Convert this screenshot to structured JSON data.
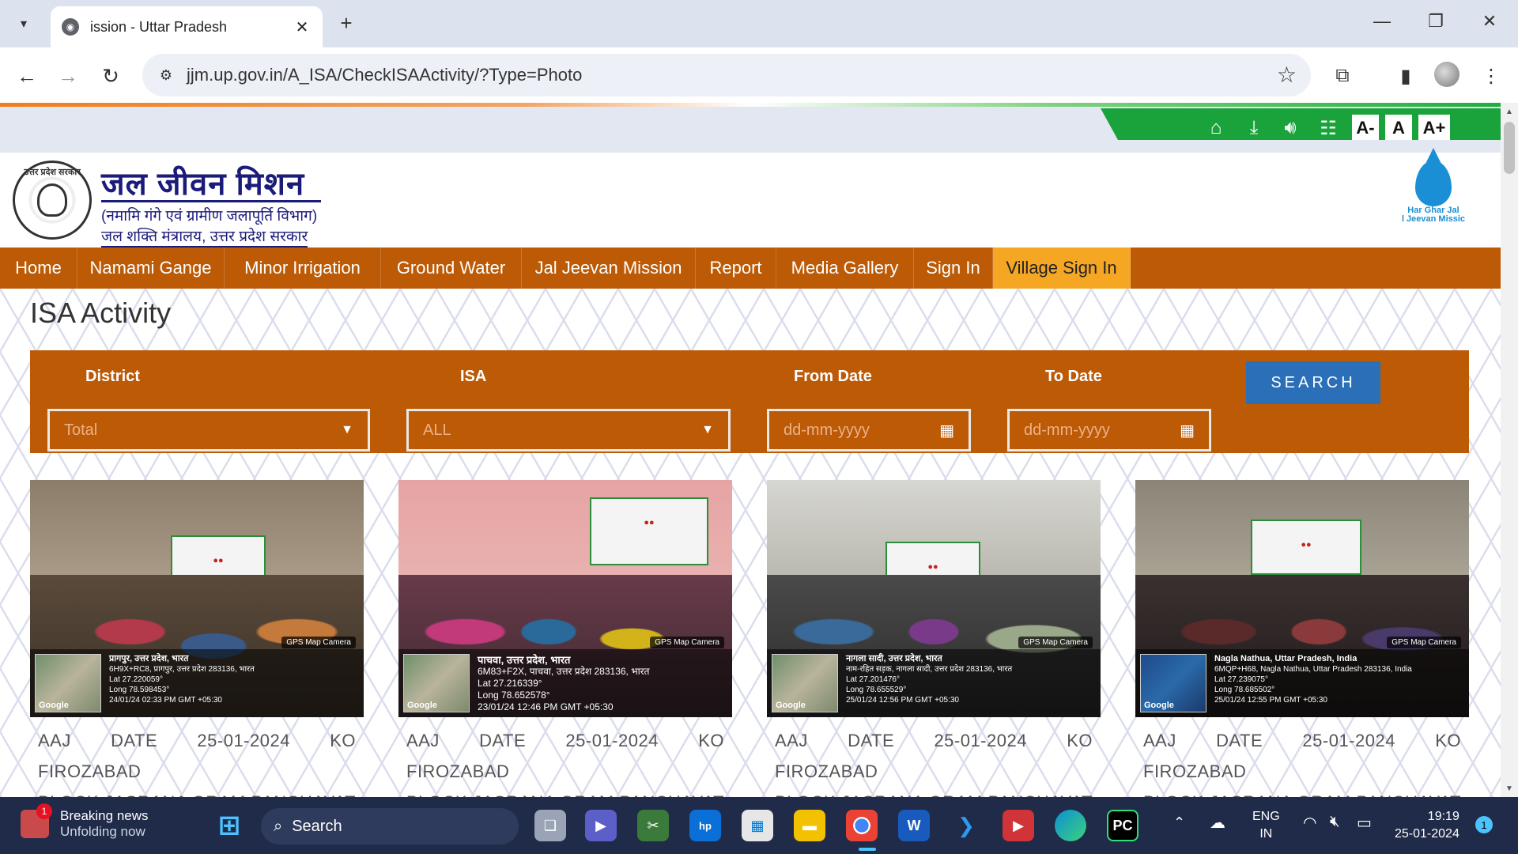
{
  "browser": {
    "tab_title": "ission - Uttar Pradesh",
    "url": "jjm.up.gov.in/A_ISA/CheckISAActivity/?Type=Photo"
  },
  "site": {
    "font_buttons": [
      "A-",
      "A",
      "A+"
    ],
    "title": "जल जीवन मिशन",
    "subtitle1": "(नमामि गंगे एवं ग्रामीण जलापूर्ति विभाग)",
    "subtitle2": "जल शक्ति मंत्रालय, उत्तर प्रदेश सरकार",
    "emblem_text": "उत्तर प्रदेश सरकार",
    "logo_right_line1": "Har Ghar Jal",
    "logo_right_line2": "l Jeevan Missic"
  },
  "menu": [
    "Home",
    "Namami Gange",
    "Minor Irrigation",
    "Ground Water",
    "Jal Jeevan Mission",
    "Report",
    "Media Gallery",
    "Sign In",
    "Village Sign In"
  ],
  "page": {
    "title": "ISA Activity",
    "filters": {
      "district_label": "District",
      "district_value": "Total",
      "isa_label": "ISA",
      "isa_value": "ALL",
      "from_label": "From Date",
      "from_placeholder": "dd-mm-yyyy",
      "to_label": "To Date",
      "to_placeholder": "dd-mm-yyyy",
      "search_label": "SEARCH"
    }
  },
  "cards": [
    {
      "gps_label": "GPS Map Camera",
      "map_label": "Google",
      "geo_line1": "प्रागपुर, उत्तर प्रदेश, भारत",
      "geo_line2": "6H9X+RC8, प्रागपुर, उत्तर प्रदेश 283136, भारत",
      "geo_line3": "Lat 27.220059°",
      "geo_line4": "Long 78.598453°",
      "geo_line5": "24/01/24 02:33 PM GMT +05:30",
      "caption_line1": "AAJ DATE 25-01-2024 KO FIROZABAD",
      "caption_line2": "BLOCK JASRANA GRAM PANCHAYAT"
    },
    {
      "gps_label": "GPS Map Camera",
      "map_label": "Google",
      "geo_line1": "पाचवा, उत्तर प्रदेश, भारत",
      "geo_line2": "6M83+F2X, पाचवा, उत्तर प्रदेश 283136, भारत",
      "geo_line3": "Lat 27.216339°",
      "geo_line4": "Long 78.652578°",
      "geo_line5": "23/01/24 12:46 PM GMT +05:30",
      "caption_line1": "AAJ DATE 25-01-2024 KO FIROZABAD",
      "caption_line2": "BLOCK JASRANA GRAM PANCHAYAT"
    },
    {
      "gps_label": "GPS Map Camera",
      "map_label": "Google",
      "geo_line1": "नागला सादी, उत्तर प्रदेश, भारत",
      "geo_line2": "नाम-रहित सड़क, नागला सादी, उत्तर प्रदेश 283136, भारत",
      "geo_line3": "Lat 27.201476°",
      "geo_line4": "Long 78.655529°",
      "geo_line5": "25/01/24 12:56 PM GMT +05:30",
      "caption_line1": "AAJ DATE 25-01-2024 KO FIROZABAD",
      "caption_line2": "BLOCK JASRANA GRAM PANCHAYAT"
    },
    {
      "gps_label": "GPS Map Camera",
      "map_label": "Google",
      "geo_line1": "Nagla Nathua, Uttar Pradesh, India",
      "geo_line2": "6MQP+H68, Nagla Nathua, Uttar Pradesh 283136, India",
      "geo_line3": "Lat 27.239075°",
      "geo_line4": "Long 78.685502°",
      "geo_line5": "25/01/24 12:55 PM GMT +05:30",
      "caption_line1": "AAJ DATE 25-01-2024 KO FIROZABAD",
      "caption_line2": "BLOCK JASRANA GRAM PANCHAYAT"
    }
  ],
  "taskbar": {
    "news_badge": "1",
    "news_title": "Breaking news",
    "news_sub": "Unfolding now",
    "search_label": "Search",
    "lang1": "ENG",
    "lang2": "IN",
    "time": "19:19",
    "date": "25-01-2024",
    "notif_count": "1"
  },
  "colors": {
    "menu_bg": "#bc5a06",
    "menu_active": "#f5a623",
    "green_bar": "#1aa33a",
    "search_button": "#2b6fb8"
  }
}
